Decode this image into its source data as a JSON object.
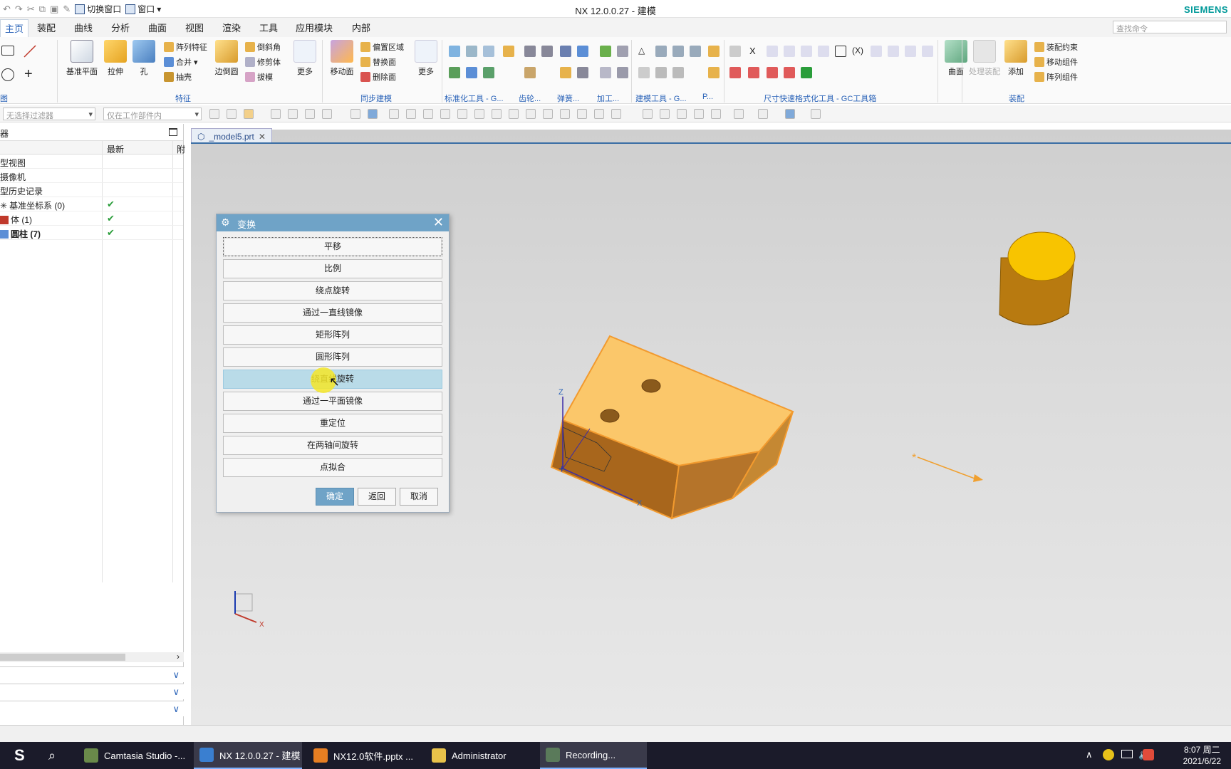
{
  "window": {
    "title": "NX 12.0.0.27 - 建模",
    "brand": "SIEMENS"
  },
  "qat": {
    "switch_window": "切换窗口",
    "window": "窗口"
  },
  "menu": {
    "tabs": [
      "主页",
      "装配",
      "曲线",
      "分析",
      "曲面",
      "视图",
      "渲染",
      "工具",
      "应用模块",
      "内部"
    ],
    "search_placeholder": "查找命令"
  },
  "ribbon": {
    "datum_plane": "基准平面",
    "extrude": "拉伸",
    "hole": "孔",
    "pattern_feature": "阵列特征",
    "unite": "合并",
    "shell": "抽壳",
    "edge_blend": "边倒圆",
    "chamfer": "倒斜角",
    "trim_body": "修剪体",
    "draft": "拔模",
    "more1": "更多",
    "move_face": "移动面",
    "offset_region": "偏置区域",
    "replace_face": "替换面",
    "delete_face": "删除面",
    "more2": "更多",
    "surface": "曲面",
    "process_assembly": "处理装配",
    "add": "添加",
    "assembly_constraint": "装配约束",
    "move_component": "移动组件",
    "pattern_component": "阵列组件",
    "groups": {
      "direct": "图",
      "feature": "特征",
      "sync": "同步建模",
      "std_tools": "标准化工具 - G...",
      "gear": "齿轮...",
      "spring": "弹簧...",
      "machining": "加工...",
      "modeling_tools": "建模工具 - G...",
      "more_p": "P...",
      "dim_tools": "尺寸快速格式化工具 - GC工具箱",
      "assembly": "装配"
    }
  },
  "selbar": {
    "filter": "无选择过滤器",
    "scope": "仅在工作部件内"
  },
  "navigator": {
    "title": "器",
    "col_latest": "最新",
    "col_extra": "附",
    "rows": [
      {
        "name": "型视图",
        "check": false
      },
      {
        "name": "摄像机",
        "check": false
      },
      {
        "name": "型历史记录",
        "check": false
      },
      {
        "name": "基准坐标系 (0)",
        "check": true
      },
      {
        "name": "体 (1)",
        "check": true
      },
      {
        "name": "圆柱 (7)",
        "check": true
      }
    ],
    "checkmark": "✔"
  },
  "document": {
    "tab": "_model5.prt"
  },
  "dialog": {
    "title": "变换",
    "options": [
      "平移",
      "比例",
      "绕点旋转",
      "通过一直线镜像",
      "矩形阵列",
      "圆形阵列",
      "绕直线旋转",
      "通过一平面镜像",
      "重定位",
      "在两轴间旋转",
      "点拟合"
    ],
    "ok": "确定",
    "back": "返回",
    "cancel": "取消"
  },
  "viewport": {
    "axis_z": "Z",
    "axis_x": "X",
    "triad_x": "X"
  },
  "taskbar": {
    "items": [
      "Camtasia Studio -...",
      "NX 12.0.0.27 - 建模",
      "NX12.0软件.pptx ...",
      "Administrator",
      "Recording..."
    ],
    "time": "8:07 周二",
    "date": "2021/6/22"
  }
}
